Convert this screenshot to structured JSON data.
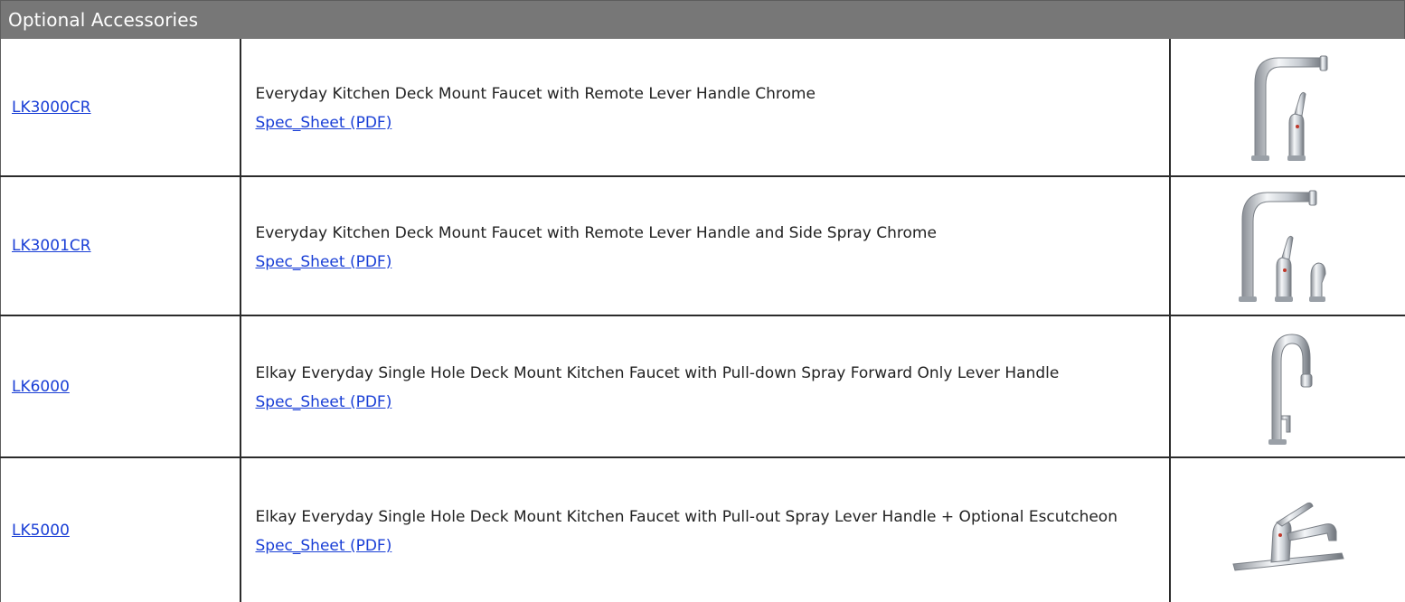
{
  "header": {
    "title": "Optional Accessories"
  },
  "products": [
    {
      "sku": "LK3000CR",
      "description": "Everyday Kitchen Deck Mount Faucet with Remote Lever Handle Chrome",
      "spec_link": "Spec_Sheet (PDF)",
      "image_icon": "faucet-remote-lever-icon"
    },
    {
      "sku": "LK3001CR",
      "description": "Everyday Kitchen Deck Mount Faucet with Remote Lever Handle and Side Spray Chrome",
      "spec_link": "Spec_Sheet (PDF)",
      "image_icon": "faucet-side-spray-icon"
    },
    {
      "sku": "LK6000",
      "description": "Elkay Everyday Single Hole Deck Mount Kitchen Faucet with Pull-down Spray Forward Only Lever Handle",
      "spec_link": "Spec_Sheet (PDF)",
      "image_icon": "faucet-pull-down-icon"
    },
    {
      "sku": "LK5000",
      "description": "Elkay Everyday Single Hole Deck Mount Kitchen Faucet with Pull-out Spray Lever Handle + Optional Escutcheon",
      "spec_link": "Spec_Sheet (PDF)",
      "image_icon": "faucet-pull-out-icon"
    }
  ],
  "colors": {
    "header_bg": "#777777",
    "link": "#1a3fd6",
    "border": "#2b2b2b"
  }
}
